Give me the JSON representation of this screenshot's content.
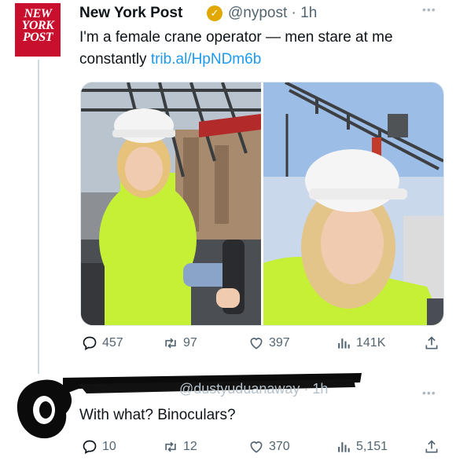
{
  "tweet": {
    "logo_lines": [
      "NEW",
      "YORK",
      "POST"
    ],
    "author_name": "New York Post",
    "handle_time": "@nypost · 1h",
    "text_main": "I'm a female crane operator — men stare at me constantly ",
    "text_link": "trib.al/HpNDm6b",
    "stats": {
      "replies": "457",
      "retweets": "97",
      "likes": "397",
      "views": "141K"
    }
  },
  "reply": {
    "handle_fragment": "@dustyuduanaway · 1h",
    "text": "With what? Binoculars?",
    "stats": {
      "replies": "10",
      "retweets": "12",
      "likes": "370",
      "views": "5,151"
    }
  },
  "colors": {
    "link": "#1d9bf0",
    "brand_red": "#c8102e",
    "muted": "#536471",
    "hi_vis": "#c6f036"
  },
  "icons": [
    "reply-icon",
    "retweet-icon",
    "like-icon",
    "views-icon",
    "share-icon",
    "verified-badge-icon",
    "more-icon"
  ]
}
